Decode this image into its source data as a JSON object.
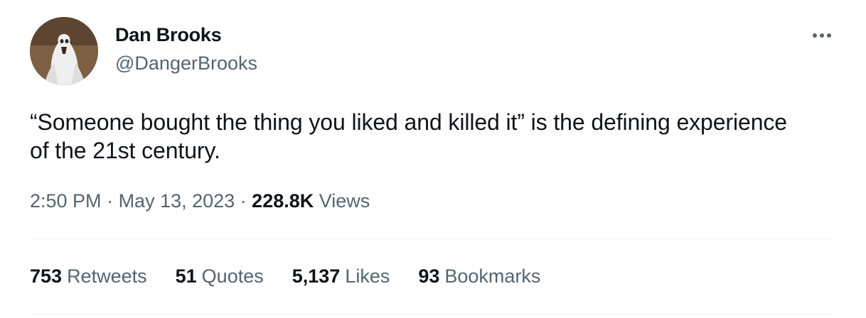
{
  "author": {
    "display_name": "Dan Brooks",
    "handle": "@DangerBrooks",
    "avatar_icon": "ghost-costume-avatar"
  },
  "more_icon": "more-horizontal-icon",
  "tweet": {
    "text": "“Someone bought the thing you liked and killed it” is the defining experience of the 21st century."
  },
  "meta": {
    "time": "2:50 PM",
    "separator": " · ",
    "date": "May 13, 2023",
    "views_count": "228.8K",
    "views_label": "Views"
  },
  "stats": {
    "retweets_count": "753",
    "retweets_label": "Retweets",
    "quotes_count": "51",
    "quotes_label": "Quotes",
    "likes_count": "5,137",
    "likes_label": "Likes",
    "bookmarks_count": "93",
    "bookmarks_label": "Bookmarks"
  },
  "colors": {
    "text_primary": "#0f1419",
    "text_secondary": "#536471",
    "divider": "#eff3f4"
  }
}
